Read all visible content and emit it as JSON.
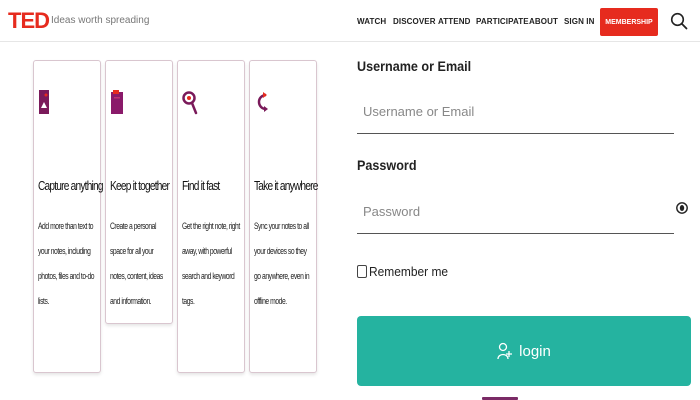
{
  "header": {
    "logo": "TED",
    "tagline": "Ideas worth spreading",
    "nav": [
      "WATCH",
      "DISCOVER",
      "ATTEND",
      "PARTICIPATE",
      "ABOUT",
      "SIGN IN"
    ],
    "membership_label": "MEMBERSHIP",
    "search_icon": "search-icon",
    "colors": {
      "brand": "#e62b1e"
    }
  },
  "features": [
    {
      "icon": "tag-icon",
      "title": "Capture anything",
      "desc": "Add more than text to your notes, including photos, files and to-do lists."
    },
    {
      "icon": "notebook-icon",
      "title": "Keep it together",
      "desc": "Create a personal space for all your notes, content, ideas and information."
    },
    {
      "icon": "magnifier-icon",
      "title": "Find it fast",
      "desc": "Get the right note, right away, with powerful search and keyword tags."
    },
    {
      "icon": "sync-icon",
      "title": "Take it anywhere",
      "desc": "Sync your notes to all your devices so they go anywhere, even in offline mode."
    }
  ],
  "login": {
    "username_label": "Username or Email",
    "username_placeholder": "Username or Email",
    "username_value": "",
    "password_label": "Password",
    "password_placeholder": "Password",
    "password_value": "",
    "remember_label": "Remember me",
    "remember_checked": false,
    "submit_label": "login",
    "colors": {
      "accent": "#25b3a0",
      "icon": "#7a1a5a"
    }
  }
}
